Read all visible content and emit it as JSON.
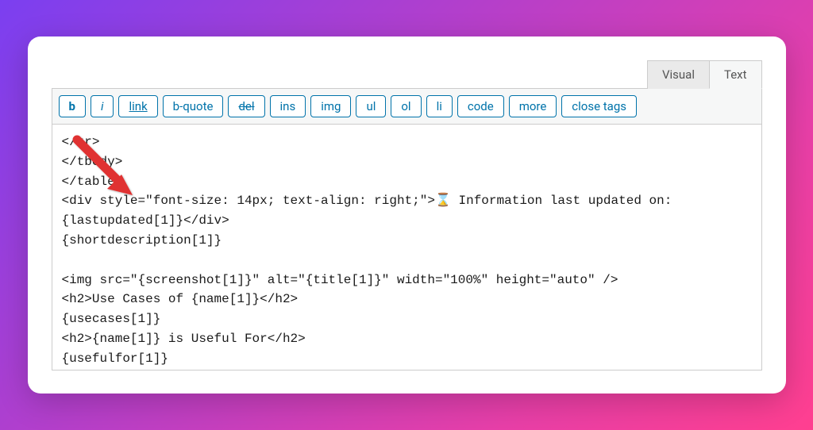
{
  "tabs": {
    "visual": "Visual",
    "text": "Text"
  },
  "toolbar": {
    "bold": "b",
    "italic": "i",
    "link": "link",
    "bquote": "b-quote",
    "del": "del",
    "ins": "ins",
    "img": "img",
    "ul": "ul",
    "ol": "ol",
    "li": "li",
    "code": "code",
    "more": "more",
    "closetags": "close tags"
  },
  "code": {
    "content": "</tr>\n</tbody>\n</table>\n<div style=\"font-size: 14px; text-align: right;\">⌛ Information last updated on: {lastupdated[1]}</div>\n{shortdescription[1]}\n\n<img src=\"{screenshot[1]}\" alt=\"{title[1]}\" width=\"100%\" height=\"auto\" />\n<h2>Use Cases of {name[1]}</h2>\n{usecases[1]}\n<h2>{name[1]} is Useful For</h2>\n{usefulfor[1]}"
  },
  "annotation": {
    "type": "red-arrow",
    "points_to": "div-style-line"
  }
}
